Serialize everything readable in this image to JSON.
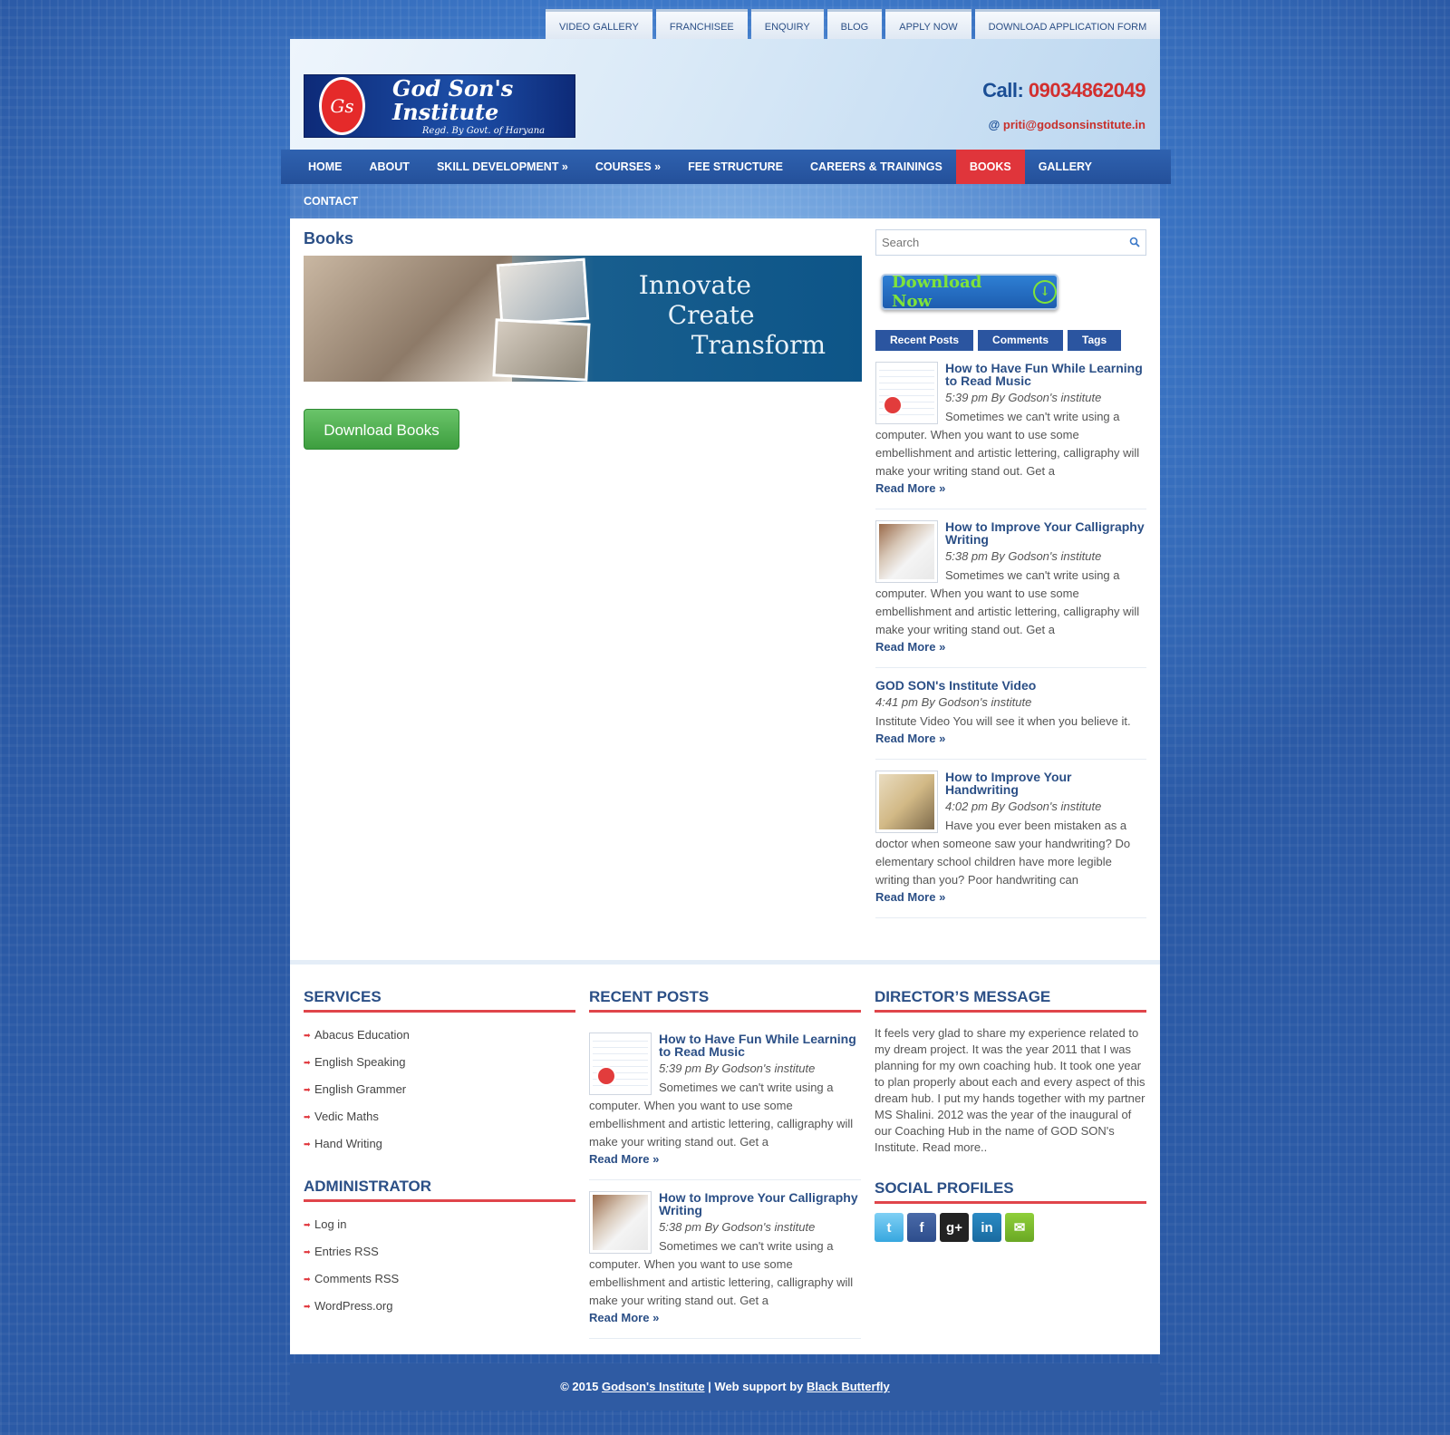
{
  "top_links": [
    "VIDEO GALLERY",
    "FRANCHISEE",
    "ENQUIRY",
    "BLOG",
    "APPLY NOW",
    "DOWNLOAD APPLICATION FORM"
  ],
  "header": {
    "logo_name": "God Son's Institute",
    "logo_sub": "Regd. By Govt. of Haryana",
    "call_label": "Call:",
    "phone": "09034862049",
    "email_at": "@",
    "email": "priti@godsonsinstitute.in"
  },
  "nav": {
    "items": [
      "HOME",
      "ABOUT",
      "SKILL DEVELOPMENT »",
      "COURSES »",
      "FEE STRUCTURE",
      "CAREERS & TRAININGS",
      "BOOKS",
      "GALLERY"
    ],
    "second_row": "CONTACT"
  },
  "main": {
    "title": "Books",
    "banner_lines": [
      "Innovate",
      "Create",
      "Transform"
    ],
    "download_label": "Download Books"
  },
  "sidebar": {
    "search_placeholder": "Search",
    "download_now": "Download Now",
    "tabs": [
      "Recent Posts",
      "Comments",
      "Tags"
    ],
    "posts": [
      {
        "title": "How to Have Fun While Learning to Read Music",
        "meta": "5:39 pm By Godson's institute",
        "text": "Sometimes we can't write using a computer. When you want to use some embellishment and artistic lettering, calligraphy will make your writing stand out. Get a",
        "more": "Read More »",
        "thumb": "music"
      },
      {
        "title": "How to Improve Your Calligraphy Writing",
        "meta": "5:38 pm By Godson's institute",
        "text": "Sometimes we can't write using a computer. When you want to use some embellishment and artistic lettering, calligraphy will make your writing stand out. Get a",
        "more": "Read More »",
        "thumb": "calli"
      },
      {
        "title": "GOD SON's Institute Video",
        "meta": "4:41 pm By Godson's institute",
        "text": "Institute Video   You will see it when you believe it.",
        "more": "Read More »",
        "thumb": ""
      },
      {
        "title": "How to Improve Your Handwriting",
        "meta": "4:02 pm By Godson's institute",
        "text": "Have you ever been mistaken as a doctor when someone saw your handwriting? Do elementary school children have more legible writing than you? Poor handwriting can",
        "more": "Read More »",
        "thumb": "hand"
      }
    ]
  },
  "footer": {
    "services_title": "SERVICES",
    "services": [
      "Abacus Education",
      "English Speaking",
      "English Grammer",
      "Vedic Maths",
      "Hand Writing"
    ],
    "admin_title": "ADMINISTRATOR",
    "admin": [
      "Log in",
      "Entries RSS",
      "Comments RSS",
      "WordPress.org"
    ],
    "recent_title": "RECENT POSTS",
    "recent": [
      {
        "title": "How to Have Fun While Learning to Read Music",
        "meta": "5:39 pm By Godson's institute",
        "text": "Sometimes we can't write using a computer. When you want to use some embellishment and artistic lettering, calligraphy will make your writing stand out. Get a",
        "more": "Read More »",
        "thumb": "music"
      },
      {
        "title": "How to Improve Your Calligraphy Writing",
        "meta": "5:38 pm By Godson's institute",
        "text": "Sometimes we can't write using a computer. When you want to use some embellishment and artistic lettering, calligraphy will make your writing stand out. Get a",
        "more": "Read More »",
        "thumb": "calli"
      }
    ],
    "director_title": "DIRECTOR’S MESSAGE",
    "director_msg": "It feels very glad to share my experience related to my dream project. It was the year 2011 that I was planning for my own coaching hub. It took one year to plan properly about each and every aspect of this dream hub. I put my hands together with my partner MS Shalini. 2012 was the year of the inaugural of our Coaching Hub in the name of GOD SON's Institute. Read more..",
    "social_title": "SOCIAL PROFILES",
    "social": [
      "twitter-icon",
      "facebook-icon",
      "google-plus-icon",
      "linkedin-icon",
      "email-icon"
    ]
  },
  "copyright": {
    "prefix": "© 2015 ",
    "site": "Godson's Institute",
    "mid": " | Web support by ",
    "support": "Black Butterfly"
  }
}
